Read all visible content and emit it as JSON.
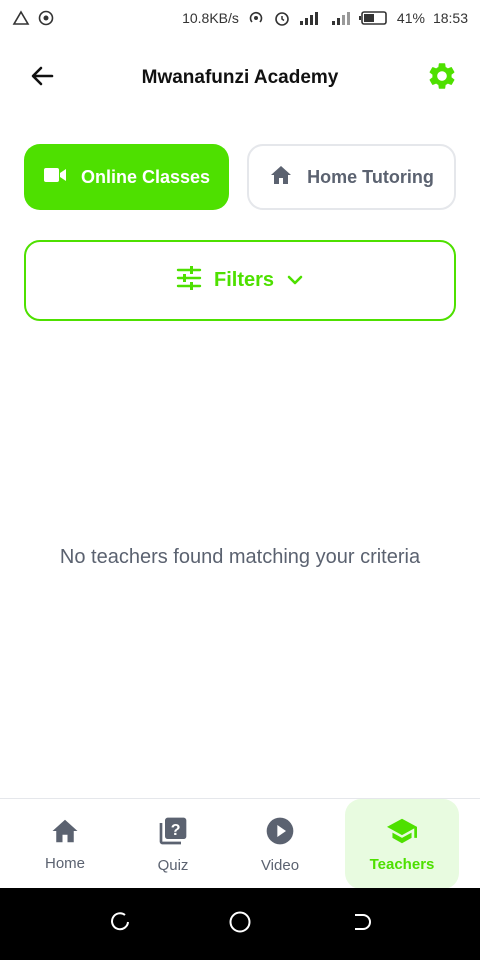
{
  "status_bar": {
    "net_speed": "10.8KB/s",
    "battery": "41%",
    "time": "18:53"
  },
  "app_bar": {
    "title": "Mwanafunzi Academy",
    "back_icon": "arrow-left-icon",
    "settings_icon": "gear-icon"
  },
  "mode_toggle": {
    "online_label": "Online Classes",
    "home_label": "Home Tutoring",
    "active": "online"
  },
  "filters": {
    "label": "Filters"
  },
  "empty_state": {
    "message": "No teachers found matching your criteria"
  },
  "bottom_nav": {
    "items": [
      {
        "label": "Home",
        "icon": "home-icon"
      },
      {
        "label": "Quiz",
        "icon": "quiz-icon"
      },
      {
        "label": "Video",
        "icon": "play-icon"
      },
      {
        "label": "Teachers",
        "icon": "school-icon"
      }
    ],
    "active": "Teachers"
  },
  "colors": {
    "accent": "#4ee000",
    "text_muted": "#5b6270",
    "active_bg": "#e8fbe0"
  }
}
